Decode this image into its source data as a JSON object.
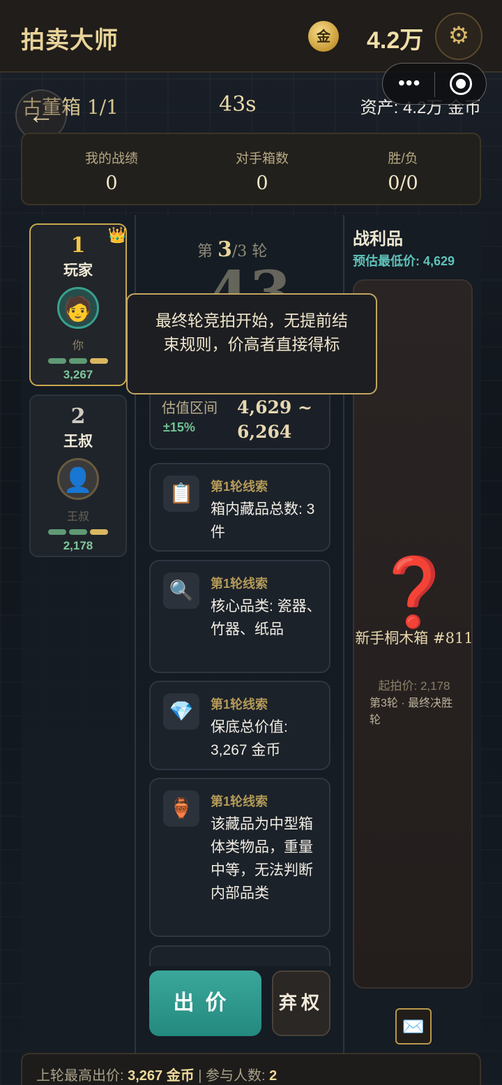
{
  "header": {
    "title": "拍卖大师",
    "coin_glyph": "金",
    "balance": "4.2万",
    "settings_icon": "gear-icon"
  },
  "capsule": {
    "more": "•••",
    "close_icon": "target-icon"
  },
  "status": {
    "box_label": "古董箱 1/1",
    "timer": "43s",
    "assets": "资产: 4.2万 金币"
  },
  "stats": [
    {
      "label": "我的战绩",
      "value": "0"
    },
    {
      "label": "对手箱数",
      "value": "0"
    },
    {
      "label": "胜/负",
      "value": "0/0"
    }
  ],
  "players": [
    {
      "rank": "1",
      "name": "玩家",
      "tag": "你",
      "score": "3,267",
      "avatar": "🧑",
      "leader": true
    },
    {
      "rank": "2",
      "name": "王叔",
      "tag": "王叔",
      "score": "2,178",
      "avatar": "👤",
      "leader": false
    }
  ],
  "round": {
    "prefix": "第",
    "current": "3",
    "total": "/3",
    "suffix": "轮",
    "countdown": "43"
  },
  "estimate": {
    "label": "估值区间",
    "percent": "±15%",
    "range": "4,629 ~ 6,264"
  },
  "clues": [
    {
      "title": "第1轮线索",
      "text": "箱内藏品总数: 3 件",
      "icon": "📋"
    },
    {
      "title": "第1轮线索",
      "text": "核心品类: 瓷器、竹器、纸品",
      "icon": "🔍"
    },
    {
      "title": "第1轮线索",
      "text": "保底总价值: 3,267 金币",
      "icon": "💎"
    },
    {
      "title": "第1轮线索",
      "text": "该藏品为中型箱体类物品，重量中等，无法判断内部品类",
      "icon": "🏺"
    }
  ],
  "spoils": {
    "title": "战利品",
    "estimate": "预估最低价: 4,629",
    "mark": "❓",
    "item_name": "新手桐木箱 #811",
    "start_price": "起拍价: 2,178",
    "round_note": "第3轮 · 最终决胜轮"
  },
  "actions": {
    "bid": "出价",
    "forfeit": "弃权"
  },
  "footer": {
    "last_bid_label": "上轮最高出价: ",
    "last_bid_value": "3,267 金币",
    "sep": " | ",
    "participants_label": "参与人数: ",
    "participants_value": "2"
  },
  "tooltip": "最终轮竞拍开始，无提前结束规则，价高者直接得标",
  "colors": {
    "gold": "#c9a94f",
    "teal": "#2a978b",
    "green": "#7fc79b",
    "bar_green": "#5f9a74",
    "bar_gold": "#d9b760"
  }
}
